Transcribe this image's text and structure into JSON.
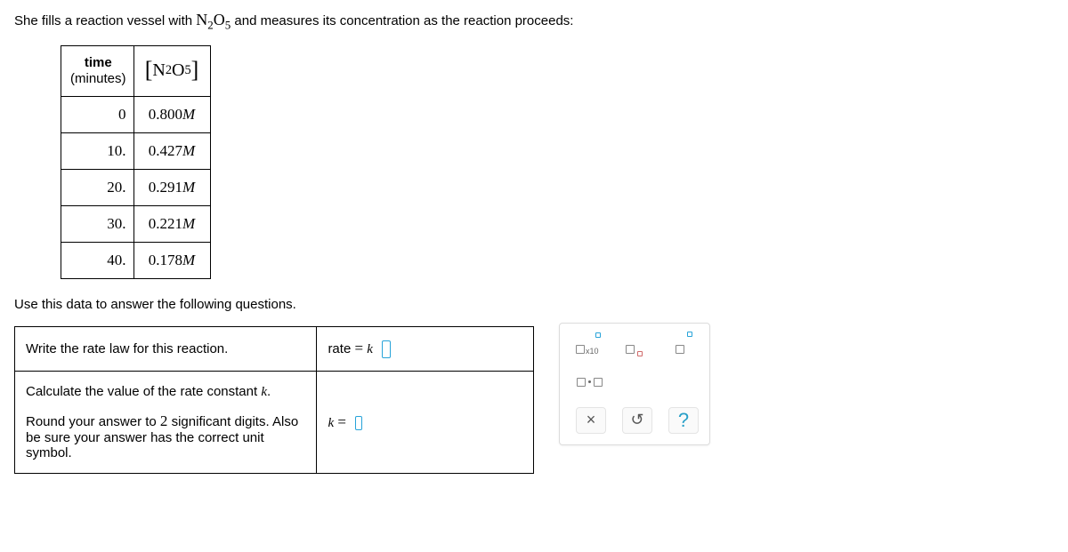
{
  "intro_pre": "She fills a reaction vessel with ",
  "intro_chem_base": "N",
  "intro_chem_sub1": "2",
  "intro_chem_mid": "O",
  "intro_chem_sub2": "5",
  "intro_post": " and measures its concentration as the reaction proceeds:",
  "table": {
    "header_time_line1": "time",
    "header_time_line2": "(minutes)",
    "header_conc_chem_base": "N",
    "header_conc_chem_sub1": "2",
    "header_conc_chem_mid": "O",
    "header_conc_chem_sub2": "5",
    "rows": [
      {
        "t": "0",
        "c": "0.800",
        "unit": "M"
      },
      {
        "t": "10.",
        "c": "0.427",
        "unit": "M"
      },
      {
        "t": "20.",
        "c": "0.291",
        "unit": "M"
      },
      {
        "t": "30.",
        "c": "0.221",
        "unit": "M"
      },
      {
        "t": "40.",
        "c": "0.178",
        "unit": "M"
      }
    ]
  },
  "prompt2": "Use this data to answer the following questions.",
  "q1": {
    "prompt": "Write the rate law for this reaction.",
    "answer_prefix": "rate ",
    "answer_eq": "= ",
    "answer_k": "k"
  },
  "q2": {
    "prompt_line1_a": "Calculate the value of the rate constant ",
    "prompt_k": "k",
    "prompt_line1_b": ".",
    "prompt_line2_a": "Round your answer to ",
    "prompt_sig": "2",
    "prompt_line2_b": " significant digits. Also be sure your answer has the correct unit symbol.",
    "answer_k": "k",
    "answer_eq": " = "
  },
  "palette": {
    "btn_x10": "x10",
    "btn_close": "×",
    "btn_undo": "↺",
    "btn_help": "?"
  },
  "chart_data": {
    "type": "table",
    "columns": [
      "time (minutes)",
      "[N2O5] (M)"
    ],
    "rows": [
      [
        0,
        0.8
      ],
      [
        10,
        0.427
      ],
      [
        20,
        0.291
      ],
      [
        30,
        0.221
      ],
      [
        40,
        0.178
      ]
    ]
  }
}
